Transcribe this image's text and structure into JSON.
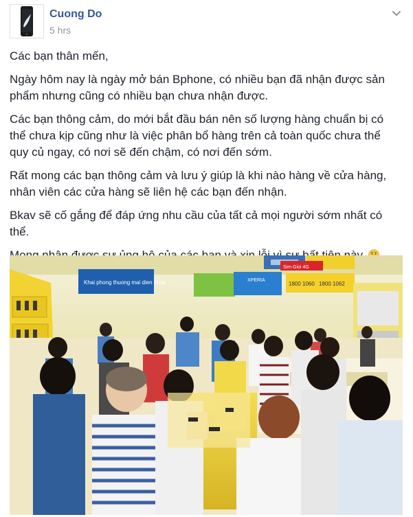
{
  "post": {
    "author": "Cuong Do",
    "time": "5 hrs",
    "paragraphs": [
      "Các bạn thân mến,",
      "Ngày hôm nay là ngày mở bán Bphone, có nhiều bạn đã nhận được sản phẩm nhưng cũng có nhiều bạn chưa nhận được.",
      "Các bạn thông cảm, do mới bắt đầu bán nên số lượng hàng chuẩn bị có thể chưa kịp cũng như là việc phân bổ hàng trên cả toàn quốc chưa thể quy củ ngay, có nơi sẽ đến chậm, có nơi đến sớm.",
      "Rất mong các bạn thông cảm và lưu ý giúp là khi nào hàng về cửa hàng, nhân viên các cửa hàng sẽ liên hệ các bạn đến nhận.",
      "Bkav sẽ cố gắng để đáp ứng nhu cầu của tất cả mọi người sớm nhất có thể.",
      "Mong nhận được sự ủng hộ của các bạn và xin lỗi vì sự bất tiện này."
    ],
    "emoji": "worried-face-icon"
  },
  "photo": {
    "signs": {
      "promo_banner": "Khai phong thuong mai dien thoai",
      "xperia": "XPERIA",
      "hotline_a": "1800 1060",
      "hotline_b": "1800 1062",
      "sim": "Sim Gioi 4G"
    }
  },
  "colors": {
    "author_name": "#365899",
    "meta": "#90949c",
    "text": "#1d2129",
    "store_yellow": "#f2d332"
  }
}
